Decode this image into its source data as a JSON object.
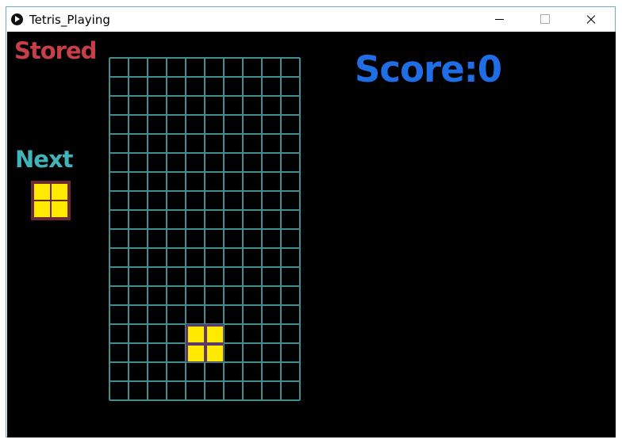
{
  "window": {
    "title": "Tetris_Playing"
  },
  "labels": {
    "stored": "Stored",
    "next": "Next",
    "score": "Score:0"
  },
  "colors": {
    "background": "#000000",
    "grid_line": "#3f8f8f",
    "stored_label": "#c74049",
    "next_label": "#3fb4bb",
    "score_label": "#1f6ee6",
    "piece_fill": "#ffea00",
    "active_piece_border": "#5b3a6b",
    "next_piece_border": "#6b2b33"
  },
  "board": {
    "columns": 10,
    "rows": 18,
    "active_piece": {
      "shape": "O",
      "cells": [
        [
          4,
          14
        ],
        [
          5,
          14
        ],
        [
          4,
          15
        ],
        [
          5,
          15
        ]
      ]
    }
  },
  "next_piece": {
    "shape": "O"
  },
  "stored_piece": null
}
